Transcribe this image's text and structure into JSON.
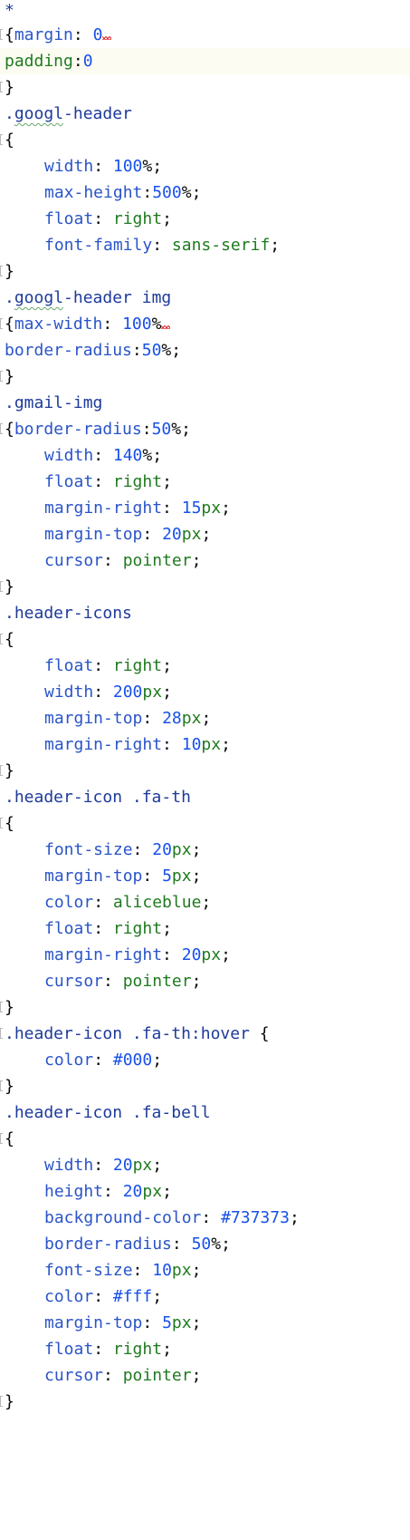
{
  "editor": {
    "lines": [
      {
        "tokens": [
          {
            "t": "*",
            "c": "t-sel"
          }
        ]
      },
      {
        "fold": true,
        "tokens": [
          {
            "t": "{",
            "c": "t-punc"
          },
          {
            "t": "margin",
            "c": "t-prop"
          },
          {
            "t": ": ",
            "c": "t-punc"
          },
          {
            "t": "0",
            "c": "t-num"
          },
          {
            "squig": true
          }
        ]
      },
      {
        "current": true,
        "tokens": [
          {
            "t": "padding",
            "c": "t-prop-green"
          },
          {
            "t": ":",
            "c": "t-punc"
          },
          {
            "t": "0",
            "c": "t-num"
          }
        ]
      },
      {
        "fold": true,
        "tokens": [
          {
            "t": "}",
            "c": "t-punc"
          }
        ]
      },
      {
        "tokens": [
          {
            "t": ".",
            "c": "t-sel"
          },
          {
            "t": "googl",
            "c": "t-sel",
            "typo": true
          },
          {
            "t": "-header",
            "c": "t-sel"
          }
        ]
      },
      {
        "fold": true,
        "tokens": [
          {
            "t": "{",
            "c": "t-punc"
          }
        ]
      },
      {
        "indent": true,
        "tokens": [
          {
            "t": "width",
            "c": "t-prop"
          },
          {
            "t": ": ",
            "c": "t-punc"
          },
          {
            "t": "100",
            "c": "t-num"
          },
          {
            "t": "%;",
            "c": "t-punc"
          }
        ]
      },
      {
        "indent": true,
        "tokens": [
          {
            "t": "max-height",
            "c": "t-prop"
          },
          {
            "t": ":",
            "c": "t-punc"
          },
          {
            "t": "500",
            "c": "t-num"
          },
          {
            "t": "%;",
            "c": "t-punc"
          }
        ]
      },
      {
        "indent": true,
        "tokens": [
          {
            "t": "float",
            "c": "t-prop"
          },
          {
            "t": ": ",
            "c": "t-punc"
          },
          {
            "t": "right",
            "c": "t-val"
          },
          {
            "t": ";",
            "c": "t-punc"
          }
        ]
      },
      {
        "indent": true,
        "tokens": [
          {
            "t": "font-family",
            "c": "t-prop"
          },
          {
            "t": ": ",
            "c": "t-punc"
          },
          {
            "t": "sans-serif",
            "c": "t-val"
          },
          {
            "t": ";",
            "c": "t-punc"
          }
        ]
      },
      {
        "fold": true,
        "tokens": [
          {
            "t": "}",
            "c": "t-punc"
          }
        ]
      },
      {
        "tokens": [
          {
            "t": ".",
            "c": "t-sel"
          },
          {
            "t": "googl",
            "c": "t-sel",
            "typo": true
          },
          {
            "t": "-header img",
            "c": "t-sel"
          }
        ]
      },
      {
        "fold": true,
        "tokens": [
          {
            "t": "{",
            "c": "t-punc"
          },
          {
            "t": "max-width",
            "c": "t-prop"
          },
          {
            "t": ": ",
            "c": "t-punc"
          },
          {
            "t": "100",
            "c": "t-num"
          },
          {
            "t": "%",
            "c": "t-punc"
          },
          {
            "squig": true
          }
        ]
      },
      {
        "tokens": [
          {
            "t": "border-radius",
            "c": "t-prop"
          },
          {
            "t": ":",
            "c": "t-punc"
          },
          {
            "t": "50",
            "c": "t-num"
          },
          {
            "t": "%;",
            "c": "t-punc"
          }
        ]
      },
      {
        "fold": true,
        "tokens": [
          {
            "t": "}",
            "c": "t-punc"
          }
        ]
      },
      {
        "tokens": [
          {
            "t": ".gmail-img",
            "c": "t-sel"
          }
        ]
      },
      {
        "fold": true,
        "tokens": [
          {
            "t": "{",
            "c": "t-punc"
          },
          {
            "t": "border-radius",
            "c": "t-prop"
          },
          {
            "t": ":",
            "c": "t-punc"
          },
          {
            "t": "50",
            "c": "t-num"
          },
          {
            "t": "%;",
            "c": "t-punc"
          }
        ]
      },
      {
        "indent": true,
        "tokens": [
          {
            "t": "width",
            "c": "t-prop"
          },
          {
            "t": ": ",
            "c": "t-punc"
          },
          {
            "t": "140",
            "c": "t-num"
          },
          {
            "t": "%;",
            "c": "t-punc"
          }
        ]
      },
      {
        "indent": true,
        "tokens": [
          {
            "t": "float",
            "c": "t-prop"
          },
          {
            "t": ": ",
            "c": "t-punc"
          },
          {
            "t": "right",
            "c": "t-val"
          },
          {
            "t": ";",
            "c": "t-punc"
          }
        ]
      },
      {
        "indent": true,
        "tokens": [
          {
            "t": "margin-right",
            "c": "t-prop"
          },
          {
            "t": ": ",
            "c": "t-punc"
          },
          {
            "t": "15",
            "c": "t-num"
          },
          {
            "t": "px",
            "c": "t-val"
          },
          {
            "t": ";",
            "c": "t-punc"
          }
        ]
      },
      {
        "indent": true,
        "tokens": [
          {
            "t": "margin-top",
            "c": "t-prop"
          },
          {
            "t": ": ",
            "c": "t-punc"
          },
          {
            "t": "20",
            "c": "t-num"
          },
          {
            "t": "px",
            "c": "t-val"
          },
          {
            "t": ";",
            "c": "t-punc"
          }
        ]
      },
      {
        "indent": true,
        "tokens": [
          {
            "t": "cursor",
            "c": "t-prop"
          },
          {
            "t": ": ",
            "c": "t-punc"
          },
          {
            "t": "pointer",
            "c": "t-val"
          },
          {
            "t": ";",
            "c": "t-punc"
          }
        ]
      },
      {
        "fold": true,
        "tokens": [
          {
            "t": "}",
            "c": "t-punc"
          }
        ]
      },
      {
        "tokens": [
          {
            "t": ".header-icons",
            "c": "t-sel"
          }
        ]
      },
      {
        "fold": true,
        "tokens": [
          {
            "t": "{",
            "c": "t-punc"
          }
        ]
      },
      {
        "indent": true,
        "tokens": [
          {
            "t": "float",
            "c": "t-prop"
          },
          {
            "t": ": ",
            "c": "t-punc"
          },
          {
            "t": "right",
            "c": "t-val"
          },
          {
            "t": ";",
            "c": "t-punc"
          }
        ]
      },
      {
        "indent": true,
        "tokens": [
          {
            "t": "width",
            "c": "t-prop"
          },
          {
            "t": ": ",
            "c": "t-punc"
          },
          {
            "t": "200",
            "c": "t-num"
          },
          {
            "t": "px",
            "c": "t-val"
          },
          {
            "t": ";",
            "c": "t-punc"
          }
        ]
      },
      {
        "indent": true,
        "tokens": [
          {
            "t": "margin-top",
            "c": "t-prop"
          },
          {
            "t": ": ",
            "c": "t-punc"
          },
          {
            "t": "28",
            "c": "t-num"
          },
          {
            "t": "px",
            "c": "t-val"
          },
          {
            "t": ";",
            "c": "t-punc"
          }
        ]
      },
      {
        "indent": true,
        "tokens": [
          {
            "t": "margin-right",
            "c": "t-prop"
          },
          {
            "t": ": ",
            "c": "t-punc"
          },
          {
            "t": "10",
            "c": "t-num"
          },
          {
            "t": "px",
            "c": "t-val"
          },
          {
            "t": ";",
            "c": "t-punc"
          }
        ]
      },
      {
        "fold": true,
        "tokens": [
          {
            "t": "}",
            "c": "t-punc"
          }
        ]
      },
      {
        "tokens": [
          {
            "t": ".header-icon .fa-th",
            "c": "t-sel"
          }
        ]
      },
      {
        "fold": true,
        "tokens": [
          {
            "t": "{",
            "c": "t-punc"
          }
        ]
      },
      {
        "indent": true,
        "tokens": [
          {
            "t": "font-size",
            "c": "t-prop"
          },
          {
            "t": ": ",
            "c": "t-punc"
          },
          {
            "t": "20",
            "c": "t-num"
          },
          {
            "t": "px",
            "c": "t-val"
          },
          {
            "t": ";",
            "c": "t-punc"
          }
        ]
      },
      {
        "indent": true,
        "tokens": [
          {
            "t": "margin-top",
            "c": "t-prop"
          },
          {
            "t": ": ",
            "c": "t-punc"
          },
          {
            "t": "5",
            "c": "t-num"
          },
          {
            "t": "px",
            "c": "t-val"
          },
          {
            "t": ";",
            "c": "t-punc"
          }
        ]
      },
      {
        "indent": true,
        "tokens": [
          {
            "t": "color",
            "c": "t-prop"
          },
          {
            "t": ": ",
            "c": "t-punc"
          },
          {
            "t": "aliceblue",
            "c": "t-val"
          },
          {
            "t": ";",
            "c": "t-punc"
          }
        ]
      },
      {
        "indent": true,
        "tokens": [
          {
            "t": "float",
            "c": "t-prop"
          },
          {
            "t": ": ",
            "c": "t-punc"
          },
          {
            "t": "right",
            "c": "t-val"
          },
          {
            "t": ";",
            "c": "t-punc"
          }
        ]
      },
      {
        "indent": true,
        "tokens": [
          {
            "t": "margin-right",
            "c": "t-prop"
          },
          {
            "t": ": ",
            "c": "t-punc"
          },
          {
            "t": "20",
            "c": "t-num"
          },
          {
            "t": "px",
            "c": "t-val"
          },
          {
            "t": ";",
            "c": "t-punc"
          }
        ]
      },
      {
        "indent": true,
        "tokens": [
          {
            "t": "cursor",
            "c": "t-prop"
          },
          {
            "t": ": ",
            "c": "t-punc"
          },
          {
            "t": "pointer",
            "c": "t-val"
          },
          {
            "t": ";",
            "c": "t-punc"
          }
        ]
      },
      {
        "fold": true,
        "tokens": [
          {
            "t": "}",
            "c": "t-punc"
          }
        ]
      },
      {
        "fold": true,
        "tokens": [
          {
            "t": ".header-icon .fa-th:hover ",
            "c": "t-sel"
          },
          {
            "t": "{",
            "c": "t-punc"
          }
        ]
      },
      {
        "indent": true,
        "tokens": [
          {
            "t": "color",
            "c": "t-prop"
          },
          {
            "t": ": ",
            "c": "t-punc"
          },
          {
            "t": "#000",
            "c": "t-num"
          },
          {
            "t": ";",
            "c": "t-punc"
          }
        ]
      },
      {
        "fold": true,
        "tokens": [
          {
            "t": "}",
            "c": "t-punc"
          }
        ]
      },
      {
        "tokens": [
          {
            "t": ".header-icon .fa-bell",
            "c": "t-sel"
          }
        ]
      },
      {
        "fold": true,
        "tokens": [
          {
            "t": "{",
            "c": "t-punc"
          }
        ]
      },
      {
        "indent": true,
        "tokens": [
          {
            "t": "width",
            "c": "t-prop"
          },
          {
            "t": ": ",
            "c": "t-punc"
          },
          {
            "t": "20",
            "c": "t-num"
          },
          {
            "t": "px",
            "c": "t-val"
          },
          {
            "t": ";",
            "c": "t-punc"
          }
        ]
      },
      {
        "indent": true,
        "tokens": [
          {
            "t": "height",
            "c": "t-prop"
          },
          {
            "t": ": ",
            "c": "t-punc"
          },
          {
            "t": "20",
            "c": "t-num"
          },
          {
            "t": "px",
            "c": "t-val"
          },
          {
            "t": ";",
            "c": "t-punc"
          }
        ]
      },
      {
        "indent": true,
        "tokens": [
          {
            "t": "background-color",
            "c": "t-prop"
          },
          {
            "t": ": ",
            "c": "t-punc"
          },
          {
            "t": "#737373",
            "c": "t-num"
          },
          {
            "t": ";",
            "c": "t-punc"
          }
        ]
      },
      {
        "indent": true,
        "tokens": [
          {
            "t": "border-radius",
            "c": "t-prop"
          },
          {
            "t": ": ",
            "c": "t-punc"
          },
          {
            "t": "50",
            "c": "t-num"
          },
          {
            "t": "%;",
            "c": "t-punc"
          }
        ]
      },
      {
        "indent": true,
        "tokens": [
          {
            "t": "font-size",
            "c": "t-prop"
          },
          {
            "t": ": ",
            "c": "t-punc"
          },
          {
            "t": "10",
            "c": "t-num"
          },
          {
            "t": "px",
            "c": "t-val"
          },
          {
            "t": ";",
            "c": "t-punc"
          }
        ]
      },
      {
        "indent": true,
        "tokens": [
          {
            "t": "color",
            "c": "t-prop"
          },
          {
            "t": ": ",
            "c": "t-punc"
          },
          {
            "t": "#fff",
            "c": "t-num"
          },
          {
            "t": ";",
            "c": "t-punc"
          }
        ]
      },
      {
        "indent": true,
        "tokens": [
          {
            "t": "margin-top",
            "c": "t-prop"
          },
          {
            "t": ": ",
            "c": "t-punc"
          },
          {
            "t": "5",
            "c": "t-num"
          },
          {
            "t": "px",
            "c": "t-val"
          },
          {
            "t": ";",
            "c": "t-punc"
          }
        ]
      },
      {
        "indent": true,
        "tokens": [
          {
            "t": "float",
            "c": "t-prop"
          },
          {
            "t": ": ",
            "c": "t-punc"
          },
          {
            "t": "right",
            "c": "t-val"
          },
          {
            "t": ";",
            "c": "t-punc"
          }
        ]
      },
      {
        "indent": true,
        "tokens": [
          {
            "t": "cursor",
            "c": "t-prop"
          },
          {
            "t": ": ",
            "c": "t-punc"
          },
          {
            "t": "pointer",
            "c": "t-val"
          },
          {
            "t": ";",
            "c": "t-punc"
          }
        ]
      },
      {
        "fold": true,
        "tokens": [
          {
            "t": "}",
            "c": "t-punc"
          }
        ]
      }
    ]
  }
}
